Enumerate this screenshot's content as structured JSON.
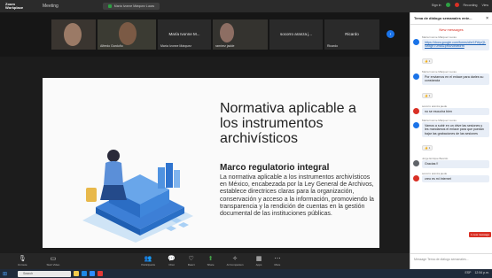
{
  "app": {
    "brand": "Zoom Workplace",
    "menu": "Meeting",
    "share_tab": "María Ivonne Márquez Lucas"
  },
  "top_right": {
    "sign_in": "Sign in",
    "recording": "Recording",
    "view": "View"
  },
  "participants": [
    {
      "name": ""
    },
    {
      "name": "Alfredo Garduño"
    },
    {
      "name": "María Ivonne Márquez",
      "big_name": "María Ivonne M..."
    },
    {
      "name": "ramírez jadde",
      "big_name": "socorro aranza j..."
    },
    {
      "name": "Ricardo",
      "big_name": "Ricardo"
    }
  ],
  "slide": {
    "title": "Normativa aplicable a los instrumentos archivísticos",
    "subtitle": "Marco regulatorio integral",
    "body": "La normativa aplicable a los instrumentos archivísticos en México, encabezada por la Ley General de Archivos, establece directrices claras para la organización, conservación y acceso a la información, promoviendo la transparencia y la rendición de cuentas en la gestión documental de las instituciones públicas."
  },
  "controls": [
    {
      "icon": "mic-icon",
      "glyph": "🎙",
      "label": "Unmute",
      "color": "red"
    },
    {
      "icon": "camera-icon",
      "glyph": "▭",
      "label": "Start Video",
      "color": ""
    },
    {
      "icon": "participants-icon",
      "glyph": "👥",
      "label": "Participants",
      "color": ""
    },
    {
      "icon": "chat-icon",
      "glyph": "💬",
      "label": "Chat",
      "color": ""
    },
    {
      "icon": "react-icon",
      "glyph": "♡",
      "label": "React",
      "color": ""
    },
    {
      "icon": "share-icon",
      "glyph": "⬆",
      "label": "Share",
      "color": "green"
    },
    {
      "icon": "ai-companion-icon",
      "glyph": "✧",
      "label": "AI Companion",
      "color": ""
    },
    {
      "icon": "apps-icon",
      "glyph": "▦",
      "label": "Apps",
      "color": ""
    },
    {
      "icon": "more-icon",
      "glyph": "⋯",
      "label": "More",
      "color": ""
    }
  ],
  "chat": {
    "title": "Tema de diálogo semanales ente...",
    "new_messages": "New messages",
    "messages": [
      {
        "author": "María Ivonne Márquez Lucas",
        "text": "https://docs.google.com/forms/d/e/1FAIpQLSe8gnT0m8IZpR8/viewform",
        "link": true,
        "reaction": "👍 1"
      },
      {
        "author": "María Ivonne Márquez Lucas",
        "text": "Por enviarnos en el enlace para darles su constancia",
        "link": false,
        "reaction": "👍 1"
      },
      {
        "author": "socorro aranza jaede",
        "text": "no se escucha bien",
        "link": false,
        "reaction": ""
      },
      {
        "author": "María Ivonne Márquez Lucas",
        "text": "Vamos a subir en un drive las sesiones y les mandamos el enlace para que puedan bajar las grabaciones de las sesiones",
        "link": false,
        "reaction": "👍 1"
      },
      {
        "author": "Jorge Enrique Besnilo",
        "text": "Gracias !!",
        "link": false,
        "reaction": ""
      },
      {
        "author": "socorro aranza jaede",
        "text": "creo es mi Internet",
        "link": false,
        "reaction": ""
      }
    ],
    "unread_badge": "1 new message",
    "input_placeholder": "Message Tema de diálogo semanales..."
  },
  "taskbar": {
    "search": "Search",
    "time": "12:54 p.m.",
    "lang": "ESP"
  }
}
